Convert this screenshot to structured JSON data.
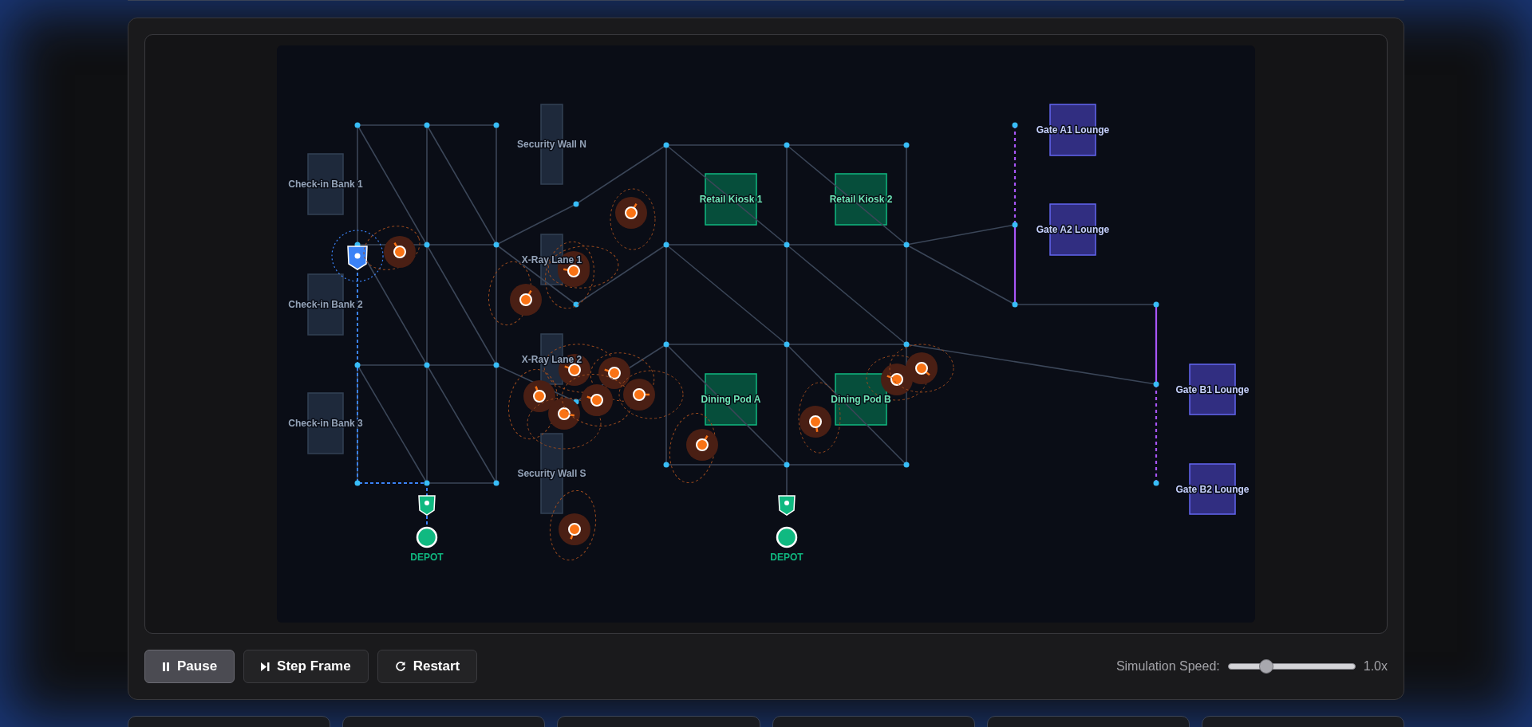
{
  "map": {
    "zones": [
      {
        "kind": "checkin",
        "label": "Check-in Bank 1"
      },
      {
        "kind": "checkin",
        "label": "Check-in Bank 2"
      },
      {
        "kind": "checkin",
        "label": "Check-in Bank 3"
      },
      {
        "kind": "security",
        "label": "Security Wall N"
      },
      {
        "kind": "security",
        "label": "X-Ray Lane 1"
      },
      {
        "kind": "security",
        "label": "X-Ray Lane 2"
      },
      {
        "kind": "security",
        "label": "Security Wall S"
      },
      {
        "kind": "retail",
        "label": "Retail Kiosk 1"
      },
      {
        "kind": "retail",
        "label": "Retail Kiosk 2"
      },
      {
        "kind": "retail",
        "label": "Dining Pod A"
      },
      {
        "kind": "retail",
        "label": "Dining Pod B"
      },
      {
        "kind": "gate",
        "label": "Gate A1 Lounge"
      },
      {
        "kind": "gate",
        "label": "Gate A2 Lounge"
      },
      {
        "kind": "gate",
        "label": "Gate B1 Lounge"
      },
      {
        "kind": "gate",
        "label": "Gate B2 Lounge"
      }
    ],
    "depots": [
      {
        "label": "DEPOT"
      },
      {
        "label": "DEPOT"
      }
    ]
  },
  "controls": {
    "buttons": [
      {
        "kind": "pause",
        "label": "Pause",
        "active": true
      },
      {
        "kind": "step",
        "label": "Step Frame",
        "active": false
      },
      {
        "kind": "restart",
        "label": "Restart",
        "active": false
      }
    ],
    "speed": {
      "label": "Simulation Speed:",
      "level": 0.3,
      "reading": "1.0x"
    }
  }
}
